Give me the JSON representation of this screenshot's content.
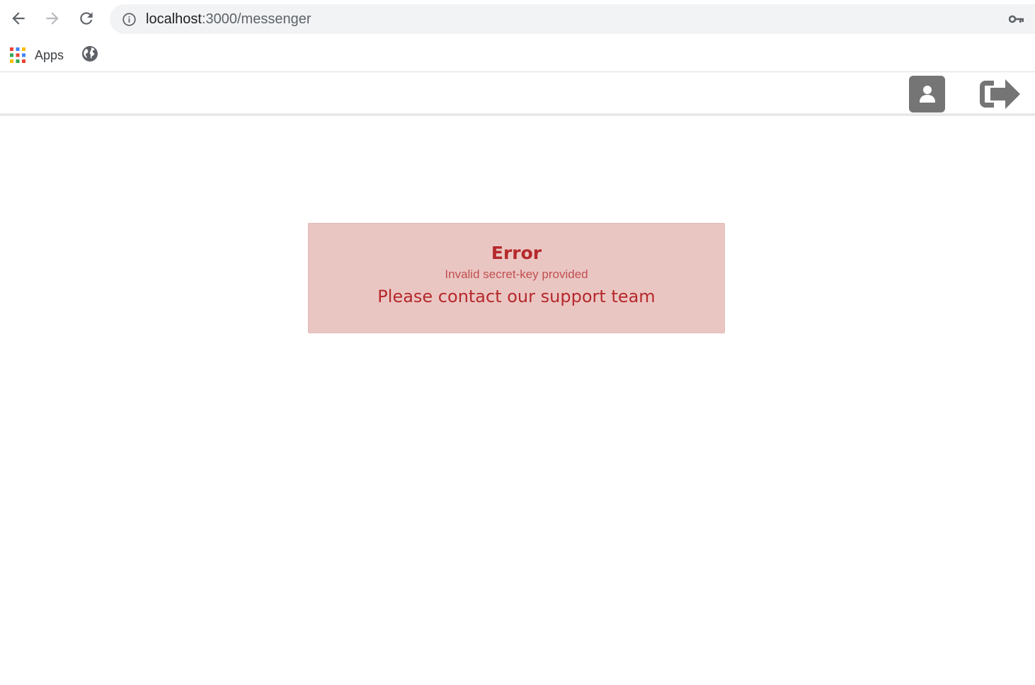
{
  "browser": {
    "url_host": "localhost",
    "url_path": ":3000/messenger",
    "bookmarks": [
      {
        "label": "Apps",
        "icon": "apps-grid-icon"
      },
      {
        "label": "",
        "icon": "globe-icon"
      }
    ]
  },
  "header": {
    "profile_icon": "user-icon",
    "logout_icon": "sign-out-icon"
  },
  "error": {
    "title": "Error",
    "subtitle": "Invalid secret-key provided",
    "message": "Please contact our support team"
  },
  "colors": {
    "card_background": "#eac6c3",
    "error_text": "#b5292b",
    "icon_grey": "#757575"
  }
}
